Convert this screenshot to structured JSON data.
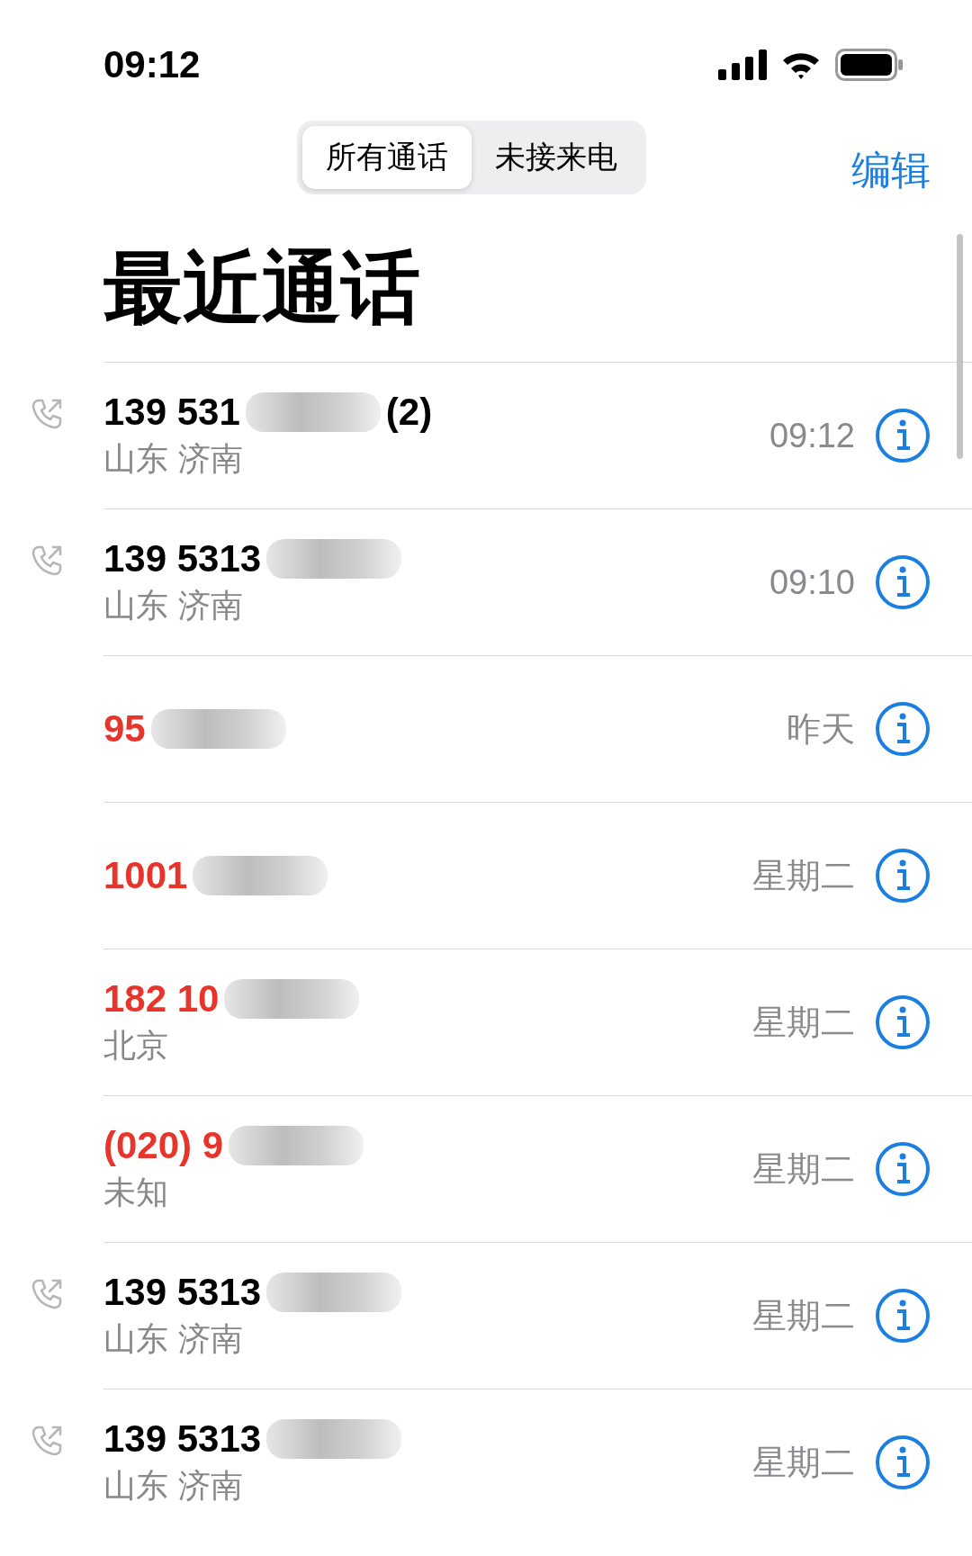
{
  "status_bar": {
    "time": "09:12"
  },
  "segments": [
    {
      "label": "所有通话",
      "selected": true
    },
    {
      "label": "未接来电",
      "selected": false
    }
  ],
  "edit_button": "编辑",
  "title": "最近通话",
  "calls": [
    {
      "number": "139 531",
      "count": "(2)",
      "location": "山东 济南",
      "time": "09:12",
      "outgoing": true,
      "missed": false,
      "redacted": true
    },
    {
      "number": "139 5313",
      "location": "山东 济南",
      "time": "09:10",
      "outgoing": true,
      "missed": false,
      "redacted": true
    },
    {
      "number": "95",
      "time": "昨天",
      "outgoing": false,
      "missed": true,
      "redacted": true
    },
    {
      "number": "1001",
      "time": "星期二",
      "outgoing": false,
      "missed": true,
      "redacted": true
    },
    {
      "number": "182 10",
      "location": "北京",
      "time": "星期二",
      "outgoing": false,
      "missed": true,
      "redacted": true
    },
    {
      "number": "(020) 9",
      "location": "未知",
      "time": "星期二",
      "outgoing": false,
      "missed": true,
      "redacted": true
    },
    {
      "number": "139 5313",
      "location": "山东 济南",
      "time": "星期二",
      "outgoing": true,
      "missed": false,
      "redacted": true
    },
    {
      "number": "139 5313",
      "location": "山东 济南",
      "time": "星期二",
      "outgoing": true,
      "missed": false,
      "redacted": true
    }
  ]
}
